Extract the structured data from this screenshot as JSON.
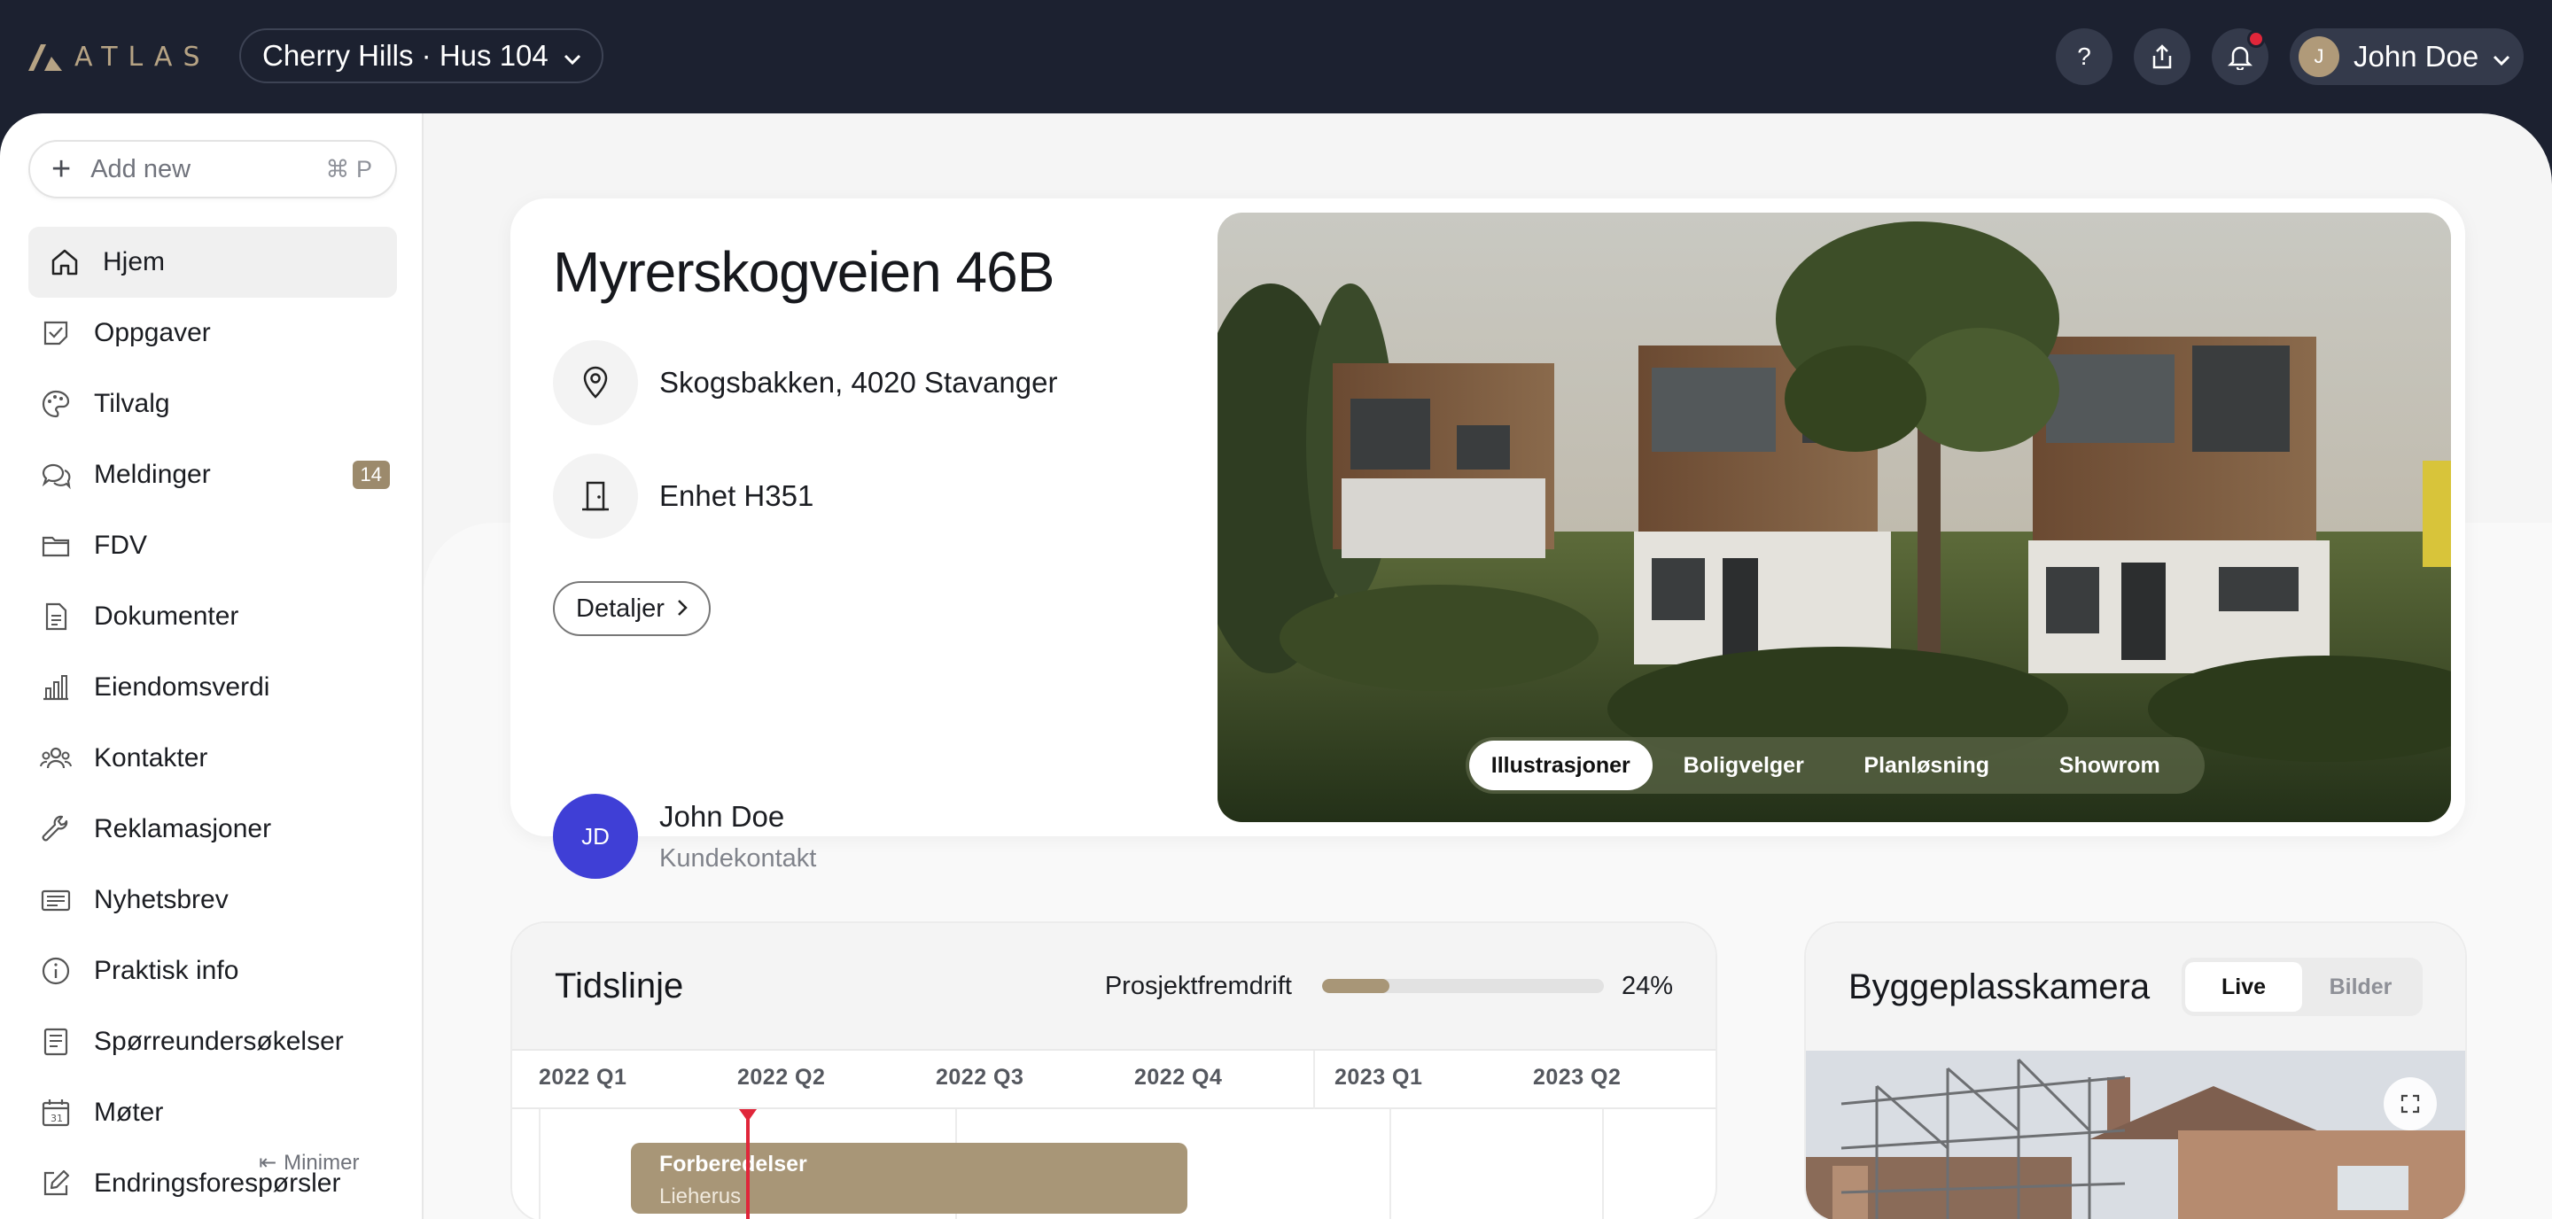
{
  "topbar": {
    "logo_text": "ATLAS",
    "project": "Cherry Hills · Hus 104",
    "help_label": "?",
    "user_initial": "J",
    "user_name": "John Doe"
  },
  "sidebar": {
    "add_new": "Add new",
    "shortcut": "⌘ P",
    "items": [
      {
        "label": "Hjem",
        "icon": "home-icon"
      },
      {
        "label": "Oppgaver",
        "icon": "tasks-icon"
      },
      {
        "label": "Tilvalg",
        "icon": "palette-icon"
      },
      {
        "label": "Meldinger",
        "icon": "chat-icon",
        "badge": "14"
      },
      {
        "label": "FDV",
        "icon": "folder-icon"
      },
      {
        "label": "Dokumenter",
        "icon": "document-icon"
      },
      {
        "label": "Eiendomsverdi",
        "icon": "bar-chart-icon"
      },
      {
        "label": "Kontakter",
        "icon": "contacts-icon"
      },
      {
        "label": "Reklamasjoner",
        "icon": "wrench-icon"
      },
      {
        "label": "Nyhetsbrev",
        "icon": "newsletter-icon"
      },
      {
        "label": "Praktisk info",
        "icon": "info-icon"
      },
      {
        "label": "Spørreundersøkelser",
        "icon": "survey-icon"
      },
      {
        "label": "Møter",
        "icon": "calendar-icon"
      },
      {
        "label": "Endringsforespørsler",
        "icon": "edit-icon"
      }
    ],
    "minimize": "Minimer"
  },
  "hero": {
    "title": "Myrerskogveien 46B",
    "address": "Skogsbakken, 4020 Stavanger",
    "unit": "Enhet H351",
    "details_button": "Detaljer",
    "contact_initials": "JD",
    "contact_name": "John Doe",
    "contact_role": "Kundekontakt",
    "image_tabs": [
      "Illustrasjoner",
      "Boligvelger",
      "Planløsning",
      "Showrom"
    ],
    "active_tab": "Illustrasjoner"
  },
  "timeline": {
    "title": "Tidslinje",
    "progress_label": "Prosjektfremdrift",
    "progress_value": 24,
    "progress_text": "24%",
    "quarters": [
      "2022 Q1",
      "2022 Q2",
      "2022 Q3",
      "2022 Q4",
      "2023 Q1",
      "2023 Q2"
    ],
    "bar_title": "Forberedelser",
    "bar_subtitle": "Lieherus"
  },
  "camera": {
    "title": "Byggeplasskamera",
    "options": [
      "Live",
      "Bilder"
    ],
    "active": "Live"
  },
  "colors": {
    "accent": "#a89677",
    "topbar": "#1c2130",
    "notification": "#e0263a",
    "contact_avatar": "#3f3fd6"
  }
}
